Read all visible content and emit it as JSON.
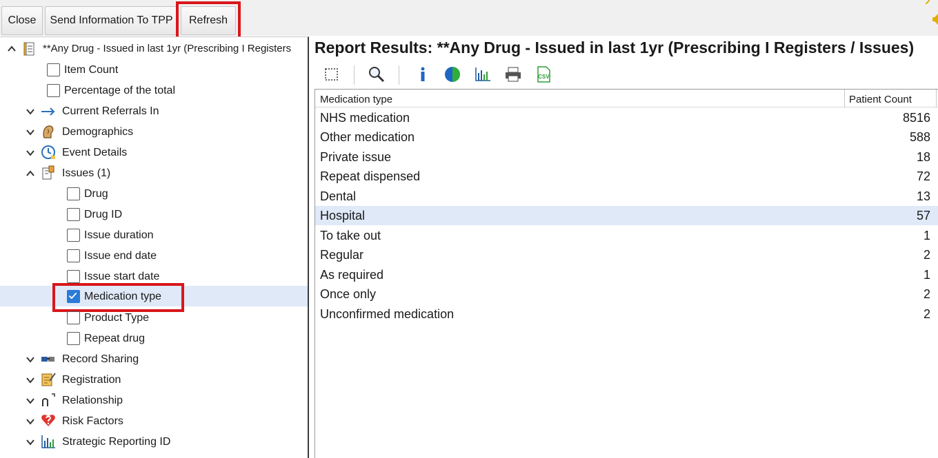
{
  "toolbar": {
    "close_label": "Close",
    "send_label": "Send Information To TPP",
    "refresh_label": "Refresh"
  },
  "tree": {
    "root_label": "**Any Drug - Issued in last 1yr (Prescribing I Registers",
    "item_count": "Item Count",
    "percentage": "Percentage of the total",
    "current_referrals": "Current Referrals In",
    "demographics": "Demographics",
    "event_details": "Event Details",
    "issues": "Issues (1)",
    "drug": "Drug",
    "drug_id": "Drug ID",
    "issue_duration": "Issue duration",
    "issue_end_date": "Issue end date",
    "issue_start_date": "Issue start date",
    "medication_type": "Medication type",
    "product_type": "Product Type",
    "repeat_drug": "Repeat drug",
    "record_sharing": "Record Sharing",
    "registration": "Registration",
    "relationship": "Relationship",
    "risk_factors": "Risk Factors",
    "strategic_reporting": "Strategic Reporting ID"
  },
  "report": {
    "title": "Report Results: **Any Drug - Issued in last 1yr (Prescribing I Registers / Issues)",
    "col_type": "Medication type",
    "col_count": "Patient Count",
    "rows": [
      {
        "type": "NHS medication",
        "count": "8516"
      },
      {
        "type": "Other medication",
        "count": "588"
      },
      {
        "type": "Private issue",
        "count": "18"
      },
      {
        "type": "Repeat dispensed",
        "count": "72"
      },
      {
        "type": "Dental",
        "count": "13"
      },
      {
        "type": "Hospital",
        "count": "57"
      },
      {
        "type": "To take out",
        "count": "1"
      },
      {
        "type": "Regular",
        "count": "2"
      },
      {
        "type": "As required",
        "count": "1"
      },
      {
        "type": "Once only",
        "count": "2"
      },
      {
        "type": "Unconfirmed medication",
        "count": "2"
      }
    ]
  },
  "colors": {
    "highlight": "#d9161b",
    "selection": "#dfe9f8",
    "checkbox_checked": "#2a7ad6"
  }
}
